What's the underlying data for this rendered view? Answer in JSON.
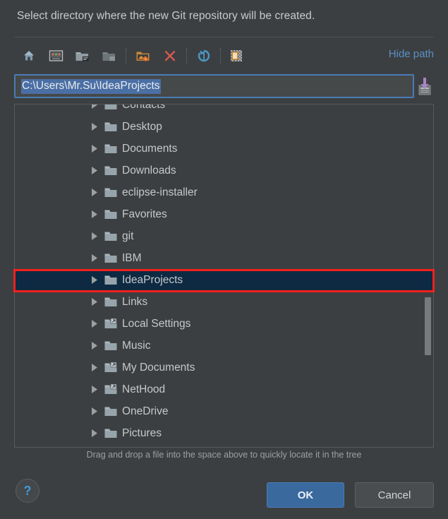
{
  "dialog": {
    "title": "Select directory where the new Git repository will be created.",
    "drag_hint": "Drag and drop a file into the space above to quickly locate it in the tree"
  },
  "toolbar": {
    "hide_path_label": "Hide path",
    "buttons": [
      {
        "name": "home-icon",
        "tooltip": "Home"
      },
      {
        "name": "desktop-icon",
        "tooltip": "Desktop"
      },
      {
        "name": "project-folder-icon",
        "tooltip": "Project Directory"
      },
      {
        "name": "module-folder-icon",
        "tooltip": "Module Directory"
      },
      {
        "name": "new-folder-icon",
        "tooltip": "New Folder"
      },
      {
        "name": "delete-icon",
        "tooltip": "Delete"
      },
      {
        "name": "refresh-icon",
        "tooltip": "Refresh"
      },
      {
        "name": "show-hidden-icon",
        "tooltip": "Show Hidden Files"
      }
    ]
  },
  "path_field": {
    "value": "C:\\Users\\Mr.Su\\IdeaProjects",
    "placeholder": "",
    "selected": true,
    "drop_icon_name": "drop-file-here-icon"
  },
  "tree": {
    "rows": [
      {
        "label": "Contacts",
        "icon": "folder",
        "selected": false,
        "partial": true
      },
      {
        "label": "Desktop",
        "icon": "folder",
        "selected": false,
        "partial": false
      },
      {
        "label": "Documents",
        "icon": "folder",
        "selected": false,
        "partial": false
      },
      {
        "label": "Downloads",
        "icon": "folder",
        "selected": false,
        "partial": false
      },
      {
        "label": "eclipse-installer",
        "icon": "folder",
        "selected": false,
        "partial": false
      },
      {
        "label": "Favorites",
        "icon": "folder",
        "selected": false,
        "partial": false
      },
      {
        "label": "git",
        "icon": "folder",
        "selected": false,
        "partial": false
      },
      {
        "label": "IBM",
        "icon": "folder",
        "selected": false,
        "partial": false
      },
      {
        "label": "IdeaProjects",
        "icon": "folder",
        "selected": true,
        "partial": false
      },
      {
        "label": "Links",
        "icon": "folder",
        "selected": false,
        "partial": false
      },
      {
        "label": "Local Settings",
        "icon": "shortcut",
        "selected": false,
        "partial": false
      },
      {
        "label": "Music",
        "icon": "folder",
        "selected": false,
        "partial": false
      },
      {
        "label": "My Documents",
        "icon": "shortcut",
        "selected": false,
        "partial": false
      },
      {
        "label": "NetHood",
        "icon": "shortcut",
        "selected": false,
        "partial": false
      },
      {
        "label": "OneDrive",
        "icon": "folder",
        "selected": false,
        "partial": false
      },
      {
        "label": "Pictures",
        "icon": "folder",
        "selected": false,
        "partial": false
      }
    ]
  },
  "footer": {
    "help_label": "?",
    "ok_label": "OK",
    "cancel_label": "Cancel"
  },
  "colors": {
    "background": "#3c3f41",
    "accent_blue": "#3a699e",
    "link_blue": "#5a90c8",
    "selection_blue": "#4a6fa5",
    "row_selected": "#0d2a42",
    "annotation_red": "#f4201c",
    "folder": "#9aa7ad"
  }
}
